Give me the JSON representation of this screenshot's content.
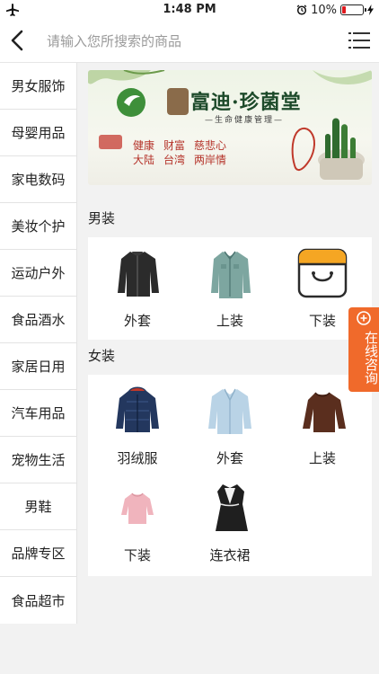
{
  "status_bar": {
    "time": "1:48 PM",
    "battery_percent": "10%"
  },
  "header": {
    "search_placeholder": "请输入您所搜索的商品"
  },
  "sidebar": {
    "items": [
      {
        "label": "男女服饰"
      },
      {
        "label": "母婴用品"
      },
      {
        "label": "家电数码"
      },
      {
        "label": "美妆个护"
      },
      {
        "label": "运动户外"
      },
      {
        "label": "食品酒水"
      },
      {
        "label": "家居日用"
      },
      {
        "label": "汽车用品"
      },
      {
        "label": "宠物生活"
      },
      {
        "label": "男鞋"
      },
      {
        "label": "品牌专区"
      },
      {
        "label": "食品超市"
      }
    ]
  },
  "banner": {
    "brand": "富迪·珍菌堂",
    "tagline": "—生命健康管理—",
    "slogan_row1": [
      "健康",
      "财富",
      "慈悲心"
    ],
    "slogan_row2": [
      "大陆",
      "台湾",
      "两岸情"
    ]
  },
  "sections": [
    {
      "title": "男装",
      "items": [
        {
          "label": "外套",
          "icon": "black-jacket-icon"
        },
        {
          "label": "上装",
          "icon": "green-shirt-icon"
        },
        {
          "label": "下装",
          "icon": "shopping-bag-icon"
        }
      ]
    },
    {
      "title": "女装",
      "items": [
        {
          "label": "羽绒服",
          "icon": "down-jacket-icon"
        },
        {
          "label": "外套",
          "icon": "light-blue-coat-icon"
        },
        {
          "label": "上装",
          "icon": "brown-sweater-icon"
        },
        {
          "label": "下装",
          "icon": "pink-top-icon"
        },
        {
          "label": "连衣裙",
          "icon": "black-dress-icon"
        }
      ]
    }
  ],
  "online_consult": {
    "label": "在线咨询"
  },
  "colors": {
    "accent": "#f06a2b",
    "battery_low": "#e0191e"
  }
}
